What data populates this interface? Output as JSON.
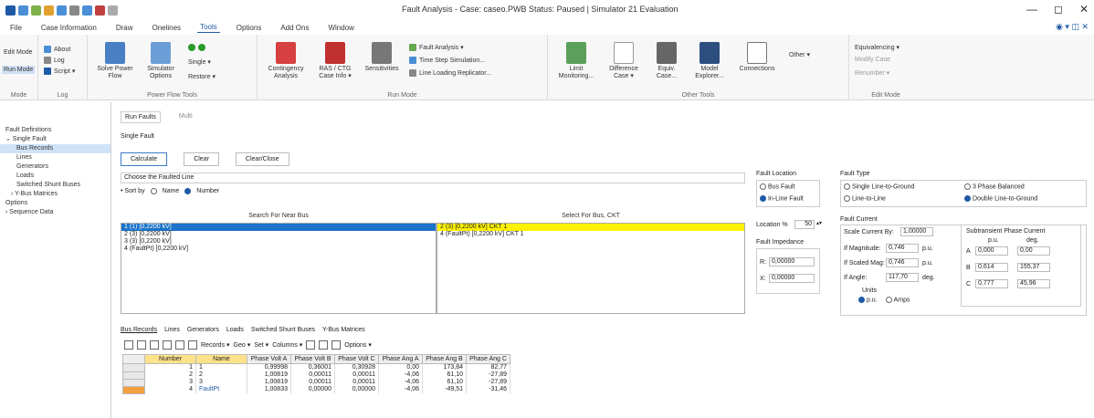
{
  "window": {
    "title": "Fault Analysis - Case: caseo.PWB Status: Paused | Simulator 21 Evaluation",
    "minimize": "—",
    "maximize": "◻",
    "close": "✕"
  },
  "menu": {
    "tabs": [
      "File",
      "Case Information",
      "Draw",
      "Onelines",
      "Tools",
      "Options",
      "Add Ons",
      "Window"
    ],
    "active": "Tools",
    "right_icons": "◉ ▾ ◫ ✕"
  },
  "ribbon": {
    "mode": {
      "edit": "Edit Mode",
      "run": "Run Mode",
      "label": "Mode"
    },
    "log": {
      "about": "About",
      "log": "Log",
      "script": "Script ▾",
      "label": "Log"
    },
    "power_flow": {
      "solve": "Solve Power Flow",
      "simulator_options": "Simulator Options",
      "step": "Single ▾",
      "restore": "Restore ▾",
      "label": "Power Flow Tools"
    },
    "run_mode": {
      "contingency": "Contingency Analysis",
      "ras": "RAS / CTG Case Info ▾",
      "sensitivities": "Sensitivities",
      "fault": "Fault Analysis ▾",
      "time_step": "Time Step Simulation...",
      "line_loading": "Line Loading Replicator...",
      "label": "Run Mode"
    },
    "other_tools": {
      "limit": "Limit Monitoring...",
      "difference": "Difference Case ▾",
      "equiv": "Equiv. Case...",
      "model": "Model Explorer...",
      "connections": "Connections",
      "other": "Other ▾",
      "label": "Other Tools"
    },
    "edit_mode": {
      "equivalencing": "Equivalencing ▾",
      "modify": "Modify Case",
      "renumber": "Renumber ▾",
      "label": "Edit Mode"
    }
  },
  "tree": {
    "items": [
      {
        "label": "Fault Definitions",
        "indent": 1
      },
      {
        "label": "⌄ Single Fault",
        "indent": 1
      },
      {
        "label": "Bus Records",
        "indent": 3,
        "selected": true
      },
      {
        "label": "Lines",
        "indent": 3
      },
      {
        "label": "Generators",
        "indent": 3
      },
      {
        "label": "Loads",
        "indent": 3
      },
      {
        "label": "Switched Shunt Buses",
        "indent": 3
      },
      {
        "label": "› Y-Bus Matrices",
        "indent": 2
      },
      {
        "label": "Options",
        "indent": 1
      },
      {
        "label": "› Sequence Data",
        "indent": 1
      }
    ]
  },
  "subtabs": {
    "run_faults": "Run Faults",
    "multi": "Multi"
  },
  "single_fault_label": "Single Fault",
  "actions": {
    "calculate": "Calculate",
    "clear": "Clear",
    "clear_close": "Clear/Close"
  },
  "choose_label": "Choose the Faulted Line",
  "sort": {
    "label": "• Sort by",
    "name": "Name",
    "number": "Number"
  },
  "search_header": "Search For Near Bus",
  "select_header": "Select For Bus, CKT",
  "near_bus_list": [
    "1 (1) [0,2200 kV]",
    "2 (3) [0,2200 kV]",
    "3 (3) [0,2200 kV]",
    "4 (FaultPt) [0,2200 kV]"
  ],
  "ckt_list": [
    "2 (3) [0,2200 kV] CKT 1",
    "4 (FaultPt) [0,2200 kV] CKT 1"
  ],
  "fault_location": {
    "title": "Fault Location",
    "bus": "Bus Fault",
    "inline": "In-Line Fault",
    "location_label": "Location %",
    "location_value": "50"
  },
  "fault_type": {
    "title": "Fault Type",
    "slg": "Single Line-to-Ground",
    "ll": "Line-to-Line",
    "three": "3 Phase Balanced",
    "dlg": "Double Line-to-Ground"
  },
  "fault_impedance": {
    "title": "Fault Impedance",
    "r_label": "R:",
    "r_value": "0,00000",
    "x_label": "X:",
    "x_value": "0,00000"
  },
  "fault_current": {
    "title": "Fault Current",
    "scale_label": "Scale Current By:",
    "scale_value": "1,00000",
    "mag_label": "If Magnitude:",
    "mag_value": "0,746",
    "mag_unit": "p.u.",
    "scaled_label": "If Scaled Mag:",
    "scaled_value": "0,746",
    "scaled_unit": "p.u.",
    "angle_label": "If Angle:",
    "angle_value": "117,70",
    "angle_unit": "deg.",
    "units_label": "Units",
    "pu": "p.u.",
    "amps": "Amps"
  },
  "subtransient": {
    "title": "Subtransient Phase Current",
    "col1": "p.u.",
    "col2": "deg.",
    "rows": [
      {
        "phase": "A",
        "mag": "0,000",
        "deg": "0,00"
      },
      {
        "phase": "B",
        "mag": "0,614",
        "deg": "155,37"
      },
      {
        "phase": "C",
        "mag": "0,777",
        "deg": "45,96"
      }
    ]
  },
  "bottom_tabs": [
    "Bus Records",
    "Lines",
    "Generators",
    "Loads",
    "Switched Shunt Buses",
    "Y-Bus Matrices"
  ],
  "toolbar": {
    "records": "Records ▾",
    "geo": "Geo ▾",
    "set": "Set ▾",
    "columns": "Columns ▾",
    "options": "Options ▾"
  },
  "grid": {
    "headers": [
      "Number",
      "Name",
      "Phase Volt A",
      "Phase Volt B",
      "Phase Volt C",
      "Phase Ang A",
      "Phase Ang B",
      "Phase Ang C"
    ],
    "rows": [
      [
        "1",
        "1",
        "0,99998",
        "0,36001",
        "0,30928",
        "0,00",
        "173,84",
        "82,77"
      ],
      [
        "2",
        "2",
        "1,00819",
        "0,00011",
        "0,00011",
        "-4,06",
        "61,10",
        "-27,89"
      ],
      [
        "3",
        "3",
        "1,00819",
        "0,00011",
        "0,00011",
        "-4,06",
        "61,10",
        "-27,89"
      ],
      [
        "4",
        "FaultPt",
        "1,00833",
        "0,00000",
        "0,00000",
        "-4,06",
        "-49,51",
        "-31,46"
      ]
    ]
  }
}
